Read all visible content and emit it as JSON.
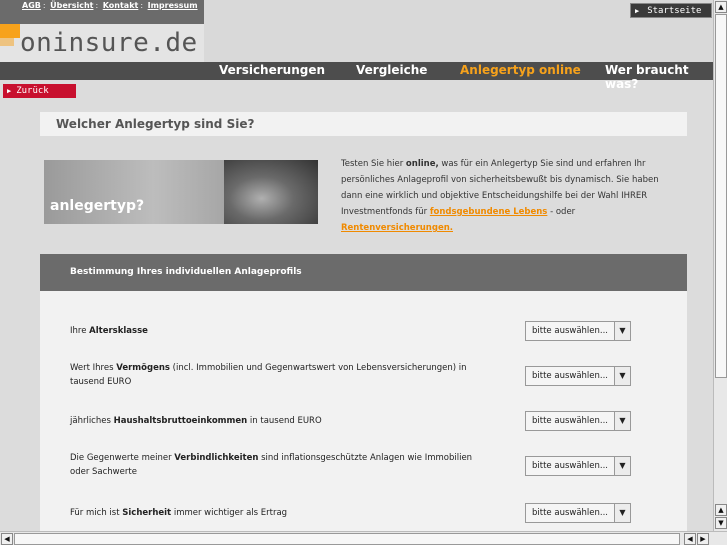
{
  "header": {
    "top_links": [
      "AGB",
      "Übersicht",
      "Kontakt",
      "Impressum"
    ],
    "logo": "oninsure.de",
    "start_button": "Startseite",
    "nav": [
      "Versicherungen",
      "Vergleiche",
      "Anlegertyp online",
      "Wer braucht was?"
    ],
    "nav_active_color": "#f7a21b"
  },
  "back_button": "Zurück",
  "page_title": "Welcher Anlegertyp sind Sie?",
  "banner_text": "anlegertyp?",
  "intro": {
    "p1": "Testen Sie hier ",
    "bold": "online,",
    "p2": " was für ein Anlegertyp Sie sind und erfahren Ihr persönliches Anlageprofil von sicherheitsbewußt bis dynamisch. Sie haben dann eine wirklich und objektive Entscheidungshilfe bei der Wahl IHRER Investmentfonds für ",
    "link1": "fondsgebundene Lebens",
    "p3": " - oder ",
    "link2": "Rentenversicherungen."
  },
  "section_title": "Bestimmung Ihres individuellen Anlageprofils",
  "questions": [
    {
      "pre": "Ihre ",
      "bold": "Altersklasse",
      "post": "",
      "select": "bitte auswählen..."
    },
    {
      "pre": "Wert Ihres ",
      "bold": "Vermögens",
      "post": " (incl. Immobilien und Gegenwartswert von Lebensversicherungen) in tausend EURO",
      "select": "bitte auswählen..."
    },
    {
      "pre": "jährliches ",
      "bold": "Haushaltsbruttoeinkommen",
      "post": " in tausend EURO",
      "select": "bitte auswählen..."
    },
    {
      "pre": "Die Gegenwerte meiner ",
      "bold": "Verbindlichkeiten",
      "post": " sind inflationsgeschützte Anlagen wie Immobilien oder Sachwerte",
      "select": "bitte auswählen..."
    },
    {
      "pre": "Für mich ist ",
      "bold": "Sicherheit",
      "post": " immer wichtiger als Ertrag",
      "select": "bitte auswählen..."
    }
  ]
}
